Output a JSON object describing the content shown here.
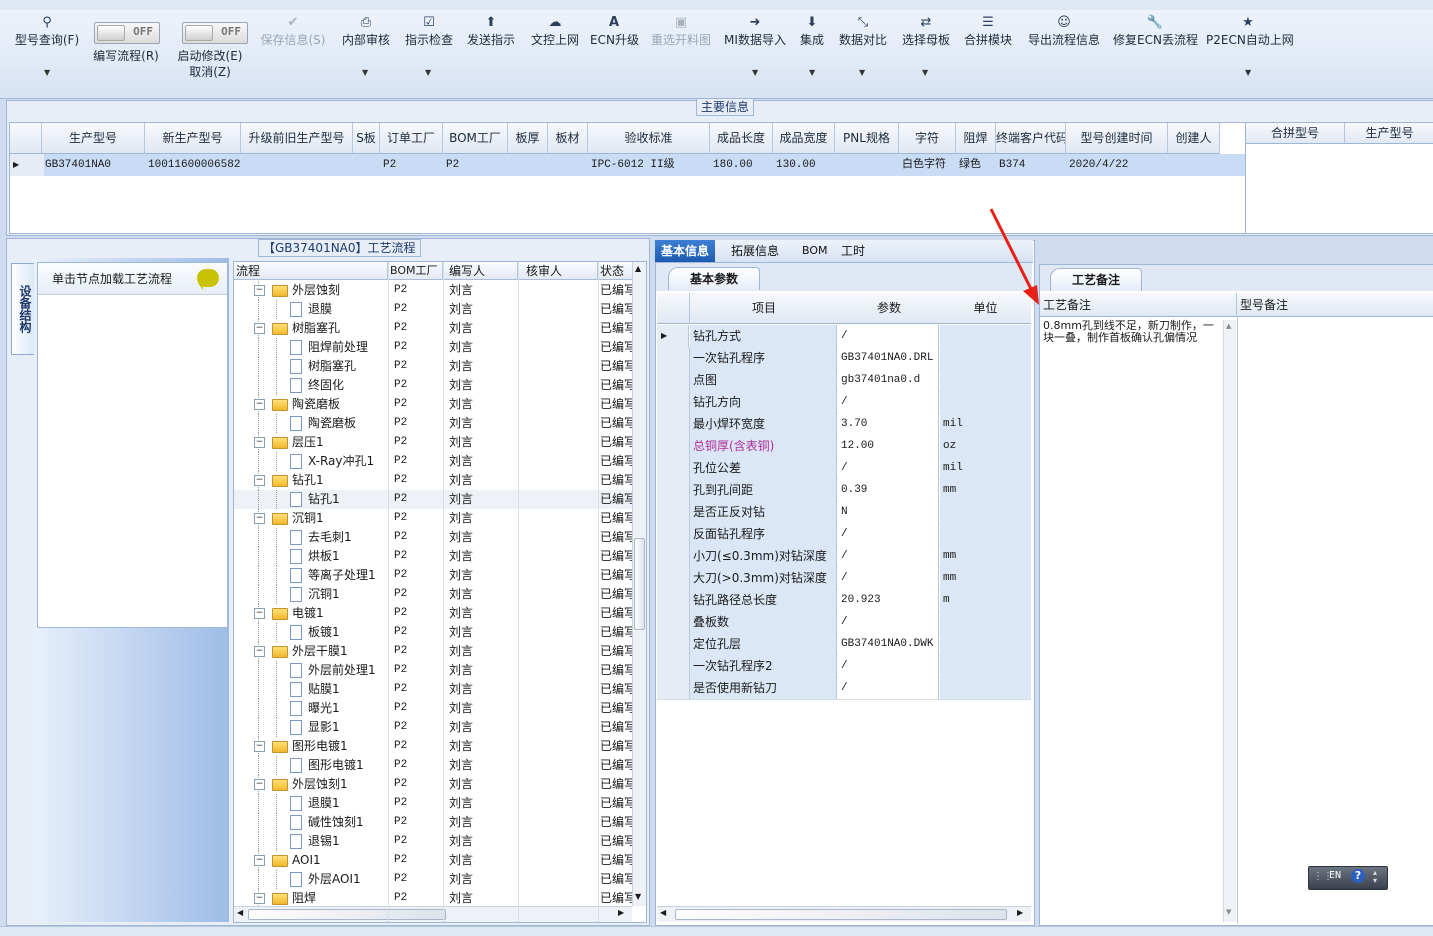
{
  "toolbar": {
    "items": [
      {
        "label": "型号查询(F)",
        "icon": "search-icon"
      },
      {
        "label": "编写流程(R)",
        "icon": "toggle"
      },
      {
        "label": "启动修改(E)",
        "icon": "toggle"
      },
      {
        "label": "取消(Z)",
        "icon": ""
      },
      {
        "label": "保存信息(S)",
        "icon": "check-icon"
      },
      {
        "label": "内部审核",
        "icon": "printer-icon"
      },
      {
        "label": "指示检查",
        "icon": "checkbox-icon"
      },
      {
        "label": "发送指示",
        "icon": "upload-icon"
      },
      {
        "label": "文控上网",
        "icon": "cloud-upload-icon"
      },
      {
        "label": "ECN升级",
        "icon": "font-icon"
      },
      {
        "label": "重选开料图",
        "icon": "image-icon"
      },
      {
        "label": "MI数据导入",
        "icon": "import-icon"
      },
      {
        "label": "集成",
        "icon": "download-icon"
      },
      {
        "label": "数据对比",
        "icon": "compare-icon"
      },
      {
        "label": "选择母板",
        "icon": "shuffle-icon"
      },
      {
        "label": "合拼模块",
        "icon": "list-icon"
      },
      {
        "label": "导出流程信息",
        "icon": "smile-icon"
      },
      {
        "label": "修复ECN丢流程",
        "icon": "wrench-icon"
      },
      {
        "label": "P2ECN自动上网",
        "icon": "star-icon"
      }
    ],
    "toggle_off": "OFF"
  },
  "main_info": {
    "legend": "主要信息",
    "columns": [
      "生产型号",
      "新生产型号",
      "升级前旧生产型号",
      "S板",
      "订单工厂",
      "BOM工厂",
      "板厚",
      "板材",
      "验收标准",
      "成品长度",
      "成品宽度",
      "PNL规格",
      "字符",
      "阻焊",
      "终端客户代码",
      "型号创建时间",
      "创建人"
    ],
    "row": [
      "GB37401NA0",
      "10011600006582",
      "",
      "",
      "P2",
      "P2",
      "",
      "",
      "IPC-6012 II级",
      "180.00",
      "130.00",
      "",
      "白色字符",
      "绿色",
      "B374",
      "2020/4/22",
      ""
    ],
    "merge_columns": [
      "合拼型号",
      "生产型号"
    ]
  },
  "process": {
    "legend": "【GB37401NA0】工艺流程",
    "side_tab": "设备结构",
    "load_hint": "单击节点加载工艺流程",
    "columns": [
      "流程",
      "BOM工厂",
      "编写人",
      "核审人",
      "状态"
    ],
    "rows": [
      {
        "name": "外层蚀刻",
        "level": 0,
        "bom": "P2",
        "writer": "刘言",
        "status": "已编写"
      },
      {
        "name": "退膜",
        "level": 1,
        "bom": "P2",
        "writer": "刘言",
        "status": "已编写"
      },
      {
        "name": "树脂塞孔",
        "level": 0,
        "bom": "P2",
        "writer": "刘言",
        "status": "已编写"
      },
      {
        "name": "阻焊前处理",
        "level": 1,
        "bom": "P2",
        "writer": "刘言",
        "status": "已编写"
      },
      {
        "name": "树脂塞孔",
        "level": 1,
        "bom": "P2",
        "writer": "刘言",
        "status": "已编写"
      },
      {
        "name": "终固化",
        "level": 1,
        "bom": "P2",
        "writer": "刘言",
        "status": "已编写"
      },
      {
        "name": "陶瓷磨板",
        "level": 0,
        "bom": "P2",
        "writer": "刘言",
        "status": "已编写"
      },
      {
        "name": "陶瓷磨板",
        "level": 1,
        "bom": "P2",
        "writer": "刘言",
        "status": "已编写"
      },
      {
        "name": "层压1",
        "level": 0,
        "bom": "P2",
        "writer": "刘言",
        "status": "已编写"
      },
      {
        "name": "X-Ray冲孔1",
        "level": 1,
        "bom": "P2",
        "writer": "刘言",
        "status": "已编写"
      },
      {
        "name": "钻孔1",
        "level": 0,
        "bom": "P2",
        "writer": "刘言",
        "status": "已编写"
      },
      {
        "name": "钻孔1",
        "level": 1,
        "bom": "P2",
        "writer": "刘言",
        "status": "已编写"
      },
      {
        "name": "沉铜1",
        "level": 0,
        "bom": "P2",
        "writer": "刘言",
        "status": "已编写"
      },
      {
        "name": "去毛刺1",
        "level": 1,
        "bom": "P2",
        "writer": "刘言",
        "status": "已编写"
      },
      {
        "name": "烘板1",
        "level": 1,
        "bom": "P2",
        "writer": "刘言",
        "status": "已编写"
      },
      {
        "name": "等离子处理1",
        "level": 1,
        "bom": "P2",
        "writer": "刘言",
        "status": "已编写"
      },
      {
        "name": "沉铜1",
        "level": 1,
        "bom": "P2",
        "writer": "刘言",
        "status": "已编写"
      },
      {
        "name": "电镀1",
        "level": 0,
        "bom": "P2",
        "writer": "刘言",
        "status": "已编写"
      },
      {
        "name": "板镀1",
        "level": 1,
        "bom": "P2",
        "writer": "刘言",
        "status": "已编写"
      },
      {
        "name": "外层干膜1",
        "level": 0,
        "bom": "P2",
        "writer": "刘言",
        "status": "已编写"
      },
      {
        "name": "外层前处理1",
        "level": 1,
        "bom": "P2",
        "writer": "刘言",
        "status": "已编写"
      },
      {
        "name": "贴膜1",
        "level": 1,
        "bom": "P2",
        "writer": "刘言",
        "status": "已编写"
      },
      {
        "name": "曝光1",
        "level": 1,
        "bom": "P2",
        "writer": "刘言",
        "status": "已编写"
      },
      {
        "name": "显影1",
        "level": 1,
        "bom": "P2",
        "writer": "刘言",
        "status": "已编写"
      },
      {
        "name": "图形电镀1",
        "level": 0,
        "bom": "P2",
        "writer": "刘言",
        "status": "已编写"
      },
      {
        "name": "图形电镀1",
        "level": 1,
        "bom": "P2",
        "writer": "刘言",
        "status": "已编写"
      },
      {
        "name": "外层蚀刻1",
        "level": 0,
        "bom": "P2",
        "writer": "刘言",
        "status": "已编写"
      },
      {
        "name": "退膜1",
        "level": 1,
        "bom": "P2",
        "writer": "刘言",
        "status": "已编写"
      },
      {
        "name": "碱性蚀刻1",
        "level": 1,
        "bom": "P2",
        "writer": "刘言",
        "status": "已编写"
      },
      {
        "name": "退锡1",
        "level": 1,
        "bom": "P2",
        "writer": "刘言",
        "status": "已编写"
      },
      {
        "name": "AOI1",
        "level": 0,
        "bom": "P2",
        "writer": "刘言",
        "status": "已编写"
      },
      {
        "name": "外层AOI1",
        "level": 1,
        "bom": "P2",
        "writer": "刘言",
        "status": "已编写"
      },
      {
        "name": "阻焊",
        "level": 0,
        "bom": "P2",
        "writer": "刘言",
        "status": "已编写"
      }
    ],
    "selected_index": 11
  },
  "detail": {
    "tabs": [
      "基本信息",
      "拓展信息",
      "BOM",
      "工时"
    ],
    "active_tab": 0,
    "sub_tab": "基本参数",
    "columns": [
      "项目",
      "参数",
      "单位"
    ],
    "rows": [
      {
        "item": "钻孔方式",
        "value": "/",
        "unit": ""
      },
      {
        "item": "一次钻孔程序",
        "value": "GB37401NA0.DRL",
        "unit": ""
      },
      {
        "item": "点图",
        "value": "gb37401na0.d",
        "unit": ""
      },
      {
        "item": "钻孔方向",
        "value": "/",
        "unit": ""
      },
      {
        "item": "最小焊环宽度",
        "value": "3.70",
        "unit": "mil"
      },
      {
        "item": "总铜厚(含表铜)",
        "value": "12.00",
        "unit": "oz",
        "highlight": true
      },
      {
        "item": "孔位公差",
        "value": "/",
        "unit": "mil"
      },
      {
        "item": "孔到孔间距",
        "value": "0.39",
        "unit": "mm"
      },
      {
        "item": "是否正反对钻",
        "value": "N",
        "unit": ""
      },
      {
        "item": "反面钻孔程序",
        "value": "/",
        "unit": ""
      },
      {
        "item": "小刀(≤0.3mm)对钻深度",
        "value": "/",
        "unit": "mm"
      },
      {
        "item": "大刀(>0.3mm)对钻深度",
        "value": "/",
        "unit": "mm"
      },
      {
        "item": "钻孔路径总长度",
        "value": "20.923",
        "unit": "m"
      },
      {
        "item": "叠板数",
        "value": "/",
        "unit": ""
      },
      {
        "item": "定位孔层",
        "value": "GB37401NA0.DWK",
        "unit": ""
      },
      {
        "item": "一次钻孔程序2",
        "value": "/",
        "unit": ""
      },
      {
        "item": "是否使用新钻刀",
        "value": "/",
        "unit": ""
      }
    ],
    "highlight_color": "#b0309a"
  },
  "notes": {
    "tab": "工艺备注",
    "columns": [
      "工艺备注",
      "型号备注"
    ],
    "process_note": "0.8mm孔到线不足，新刀制作，一块一叠，制作首板确认孔偏情况",
    "model_note": ""
  },
  "ime": {
    "label": "EN"
  },
  "colors": {
    "accent": "#1d5bb0",
    "selected_row": "#c9dcf5",
    "arrow": "#e8201a"
  }
}
